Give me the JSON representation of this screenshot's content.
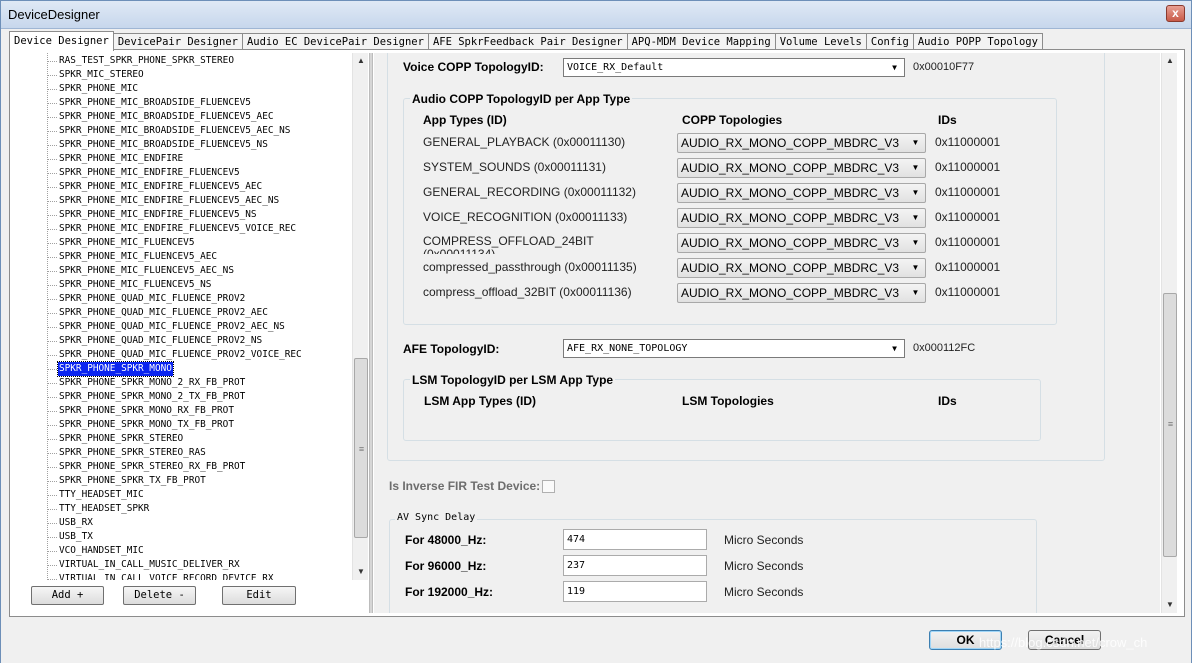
{
  "window": {
    "title": "DeviceDesigner",
    "close_glyph": "x"
  },
  "tabs": [
    {
      "label": "Device Designer",
      "active": true
    },
    {
      "label": "DevicePair Designer"
    },
    {
      "label": "Audio EC DevicePair Designer"
    },
    {
      "label": "AFE SpkrFeedback Pair Designer"
    },
    {
      "label": "APQ-MDM Device Mapping"
    },
    {
      "label": "Volume Levels"
    },
    {
      "label": "Config"
    },
    {
      "label": "Audio POPP Topology"
    }
  ],
  "device_list": {
    "items": [
      "RAS_TEST_SPKR_PHONE_SPKR_STEREO",
      "SPKR_MIC_STEREO",
      "SPKR_PHONE_MIC",
      "SPKR_PHONE_MIC_BROADSIDE_FLUENCEV5",
      "SPKR_PHONE_MIC_BROADSIDE_FLUENCEV5_AEC",
      "SPKR_PHONE_MIC_BROADSIDE_FLUENCEV5_AEC_NS",
      "SPKR_PHONE_MIC_BROADSIDE_FLUENCEV5_NS",
      "SPKR_PHONE_MIC_ENDFIRE",
      "SPKR_PHONE_MIC_ENDFIRE_FLUENCEV5",
      "SPKR_PHONE_MIC_ENDFIRE_FLUENCEV5_AEC",
      "SPKR_PHONE_MIC_ENDFIRE_FLUENCEV5_AEC_NS",
      "SPKR_PHONE_MIC_ENDFIRE_FLUENCEV5_NS",
      "SPKR_PHONE_MIC_ENDFIRE_FLUENCEV5_VOICE_REC",
      "SPKR_PHONE_MIC_FLUENCEV5",
      "SPKR_PHONE_MIC_FLUENCEV5_AEC",
      "SPKR_PHONE_MIC_FLUENCEV5_AEC_NS",
      "SPKR_PHONE_MIC_FLUENCEV5_NS",
      "SPKR_PHONE_QUAD_MIC_FLUENCE_PROV2",
      "SPKR_PHONE_QUAD_MIC_FLUENCE_PROV2_AEC",
      "SPKR_PHONE_QUAD_MIC_FLUENCE_PROV2_AEC_NS",
      "SPKR_PHONE_QUAD_MIC_FLUENCE_PROV2_NS",
      "SPKR_PHONE_QUAD_MIC_FLUENCE_PROV2_VOICE_REC",
      "SPKR_PHONE_SPKR_MONO",
      "SPKR_PHONE_SPKR_MONO_2_RX_FB_PROT",
      "SPKR_PHONE_SPKR_MONO_2_TX_FB_PROT",
      "SPKR_PHONE_SPKR_MONO_RX_FB_PROT",
      "SPKR_PHONE_SPKR_MONO_TX_FB_PROT",
      "SPKR_PHONE_SPKR_STEREO",
      "SPKR_PHONE_SPKR_STEREO_RAS",
      "SPKR_PHONE_SPKR_STEREO_RX_FB_PROT",
      "SPKR_PHONE_SPKR_TX_FB_PROT",
      "TTY_HEADSET_MIC",
      "TTY_HEADSET_SPKR",
      "USB_RX",
      "USB_TX",
      "VCO_HANDSET_MIC",
      "VIRTUAL_IN_CALL_MUSIC_DELIVER_RX",
      "VIRTUAL_IN_CALL_VOICE_RECORD_DEVICE_RX"
    ],
    "selected": "SPKR_PHONE_SPKR_MONO",
    "scroll_up_glyph": "▲",
    "scroll_down_glyph": "▼",
    "grip_glyph": "≡"
  },
  "list_buttons": {
    "add": "Add +",
    "delete": "Delete -",
    "edit": "Edit"
  },
  "voice_copp": {
    "label": "Voice COPP TopologyID:",
    "value": "VOICE_RX_Default",
    "id": "0x00010F77"
  },
  "audio_copp": {
    "group_title": "Audio COPP TopologyID per App Type",
    "headers": {
      "app_types": "App Types (ID)",
      "copp": "COPP Topologies",
      "ids": "IDs"
    },
    "rows": [
      {
        "app": "GENERAL_PLAYBACK (0x00011130)",
        "topology": "AUDIO_RX_MONO_COPP_MBDRC_V3",
        "id": "0x11000001"
      },
      {
        "app": "SYSTEM_SOUNDS (0x00011131)",
        "topology": "AUDIO_RX_MONO_COPP_MBDRC_V3",
        "id": "0x11000001"
      },
      {
        "app": "GENERAL_RECORDING (0x00011132)",
        "topology": "AUDIO_RX_MONO_COPP_MBDRC_V3",
        "id": "0x11000001"
      },
      {
        "app": "VOICE_RECOGNITION (0x00011133)",
        "topology": "AUDIO_RX_MONO_COPP_MBDRC_V3",
        "id": "0x11000001"
      },
      {
        "app": "COMPRESS_OFFLOAD_24BIT (0x00011134)",
        "topology": "AUDIO_RX_MONO_COPP_MBDRC_V3",
        "id": "0x11000001"
      },
      {
        "app": "compressed_passthrough (0x00011135)",
        "topology": "AUDIO_RX_MONO_COPP_MBDRC_V3",
        "id": "0x11000001"
      },
      {
        "app": "compress_offload_32BIT (0x00011136)",
        "topology": "AUDIO_RX_MONO_COPP_MBDRC_V3",
        "id": "0x11000001"
      }
    ]
  },
  "afe": {
    "label": "AFE TopologyID:",
    "value": "AFE_RX_NONE_TOPOLOGY",
    "id": "0x000112FC"
  },
  "lsm": {
    "group_title": "LSM TopologyID per LSM App Type",
    "headers": {
      "app_types": "LSM App Types (ID)",
      "topologies": "LSM Topologies",
      "ids": "IDs"
    }
  },
  "inverse_fir": {
    "label": "Is Inverse FIR Test Device:",
    "checked": false
  },
  "av_sync": {
    "group_title": "AV Sync Delay",
    "rows": [
      {
        "label": "For 48000_Hz:",
        "value": "474",
        "unit": "Micro Seconds"
      },
      {
        "label": "For 96000_Hz:",
        "value": "237",
        "unit": "Micro Seconds"
      },
      {
        "label": "For 192000_Hz:",
        "value": "119",
        "unit": "Micro Seconds"
      }
    ]
  },
  "dialog_buttons": {
    "ok": "OK",
    "cancel": "Cancel"
  },
  "watermark": "https://blog.csdn.net/crow_ch",
  "colors": {
    "selection": "#0a24f0",
    "title_gradient_top": "#dfe9f5",
    "title_gradient_bottom": "#c7d7ec"
  }
}
